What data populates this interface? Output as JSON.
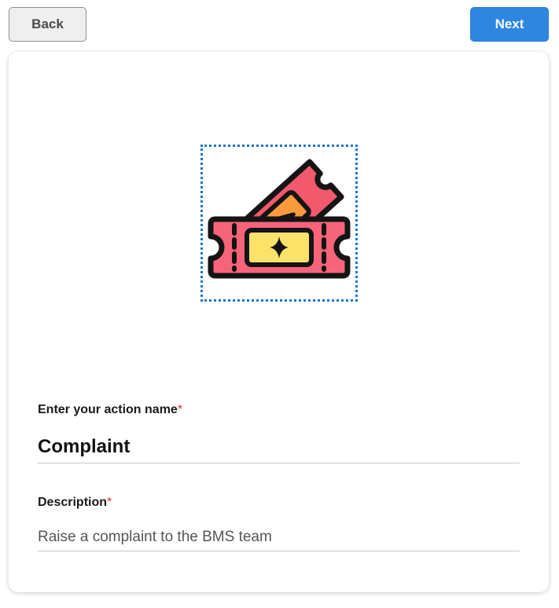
{
  "toolbar": {
    "back_label": "Back",
    "next_label": "Next"
  },
  "colors": {
    "primary": "#2e86e0",
    "required_marker": "#d93025",
    "ticket_back": "#f2596d",
    "ticket_front": "#f76479",
    "ticket_stub": "#fb9a3c",
    "ticket_center": "#fde26a"
  },
  "form": {
    "icon": "ticket-icon",
    "action_name": {
      "label": "Enter your action name",
      "required_marker": "*",
      "value": "Complaint"
    },
    "description": {
      "label": "Description",
      "required_marker": "*",
      "value": "Raise a complaint to the BMS team"
    }
  }
}
